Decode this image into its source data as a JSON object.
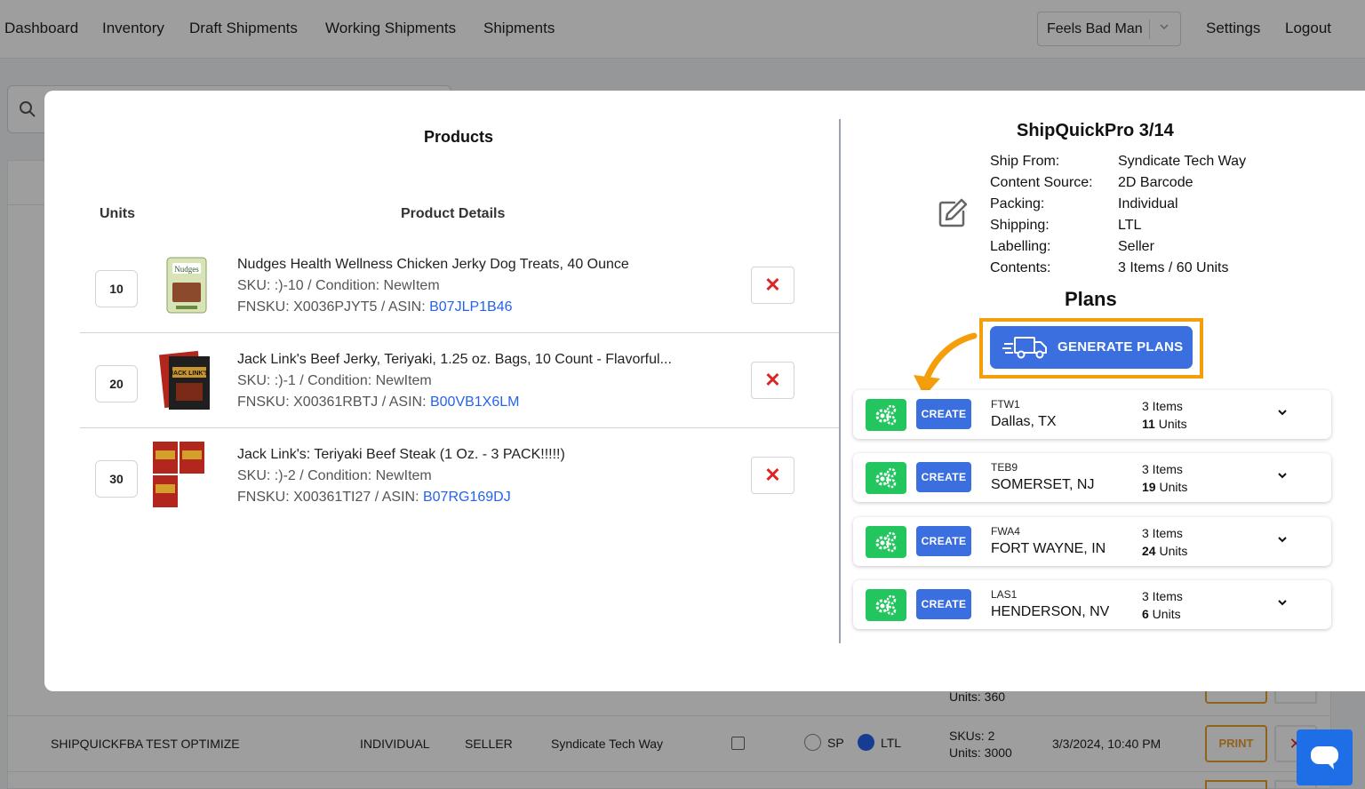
{
  "nav": {
    "items": [
      "Dashboard",
      "Inventory",
      "Draft Shipments",
      "Working Shipments",
      "Shipments"
    ],
    "account": "Feels Bad Man",
    "settings": "Settings",
    "logout": "Logout"
  },
  "background_row": {
    "name": "SHIPQUICKFBA TEST OPTIMIZE",
    "packing": "INDIVIDUAL",
    "labelling": "SELLER",
    "ship_from": "Syndicate Tech Way",
    "sp_label": "SP",
    "ltl_label": "LTL",
    "skus": "SKUs: 2",
    "units": "Units: 3000",
    "date": "3/3/2024, 10:40 PM",
    "print_label": "PRINT",
    "prev_units": "Units: 360"
  },
  "products": {
    "title": "Products",
    "col_units": "Units",
    "col_details": "Product Details",
    "items": [
      {
        "qty": "10",
        "name": "Nudges Health Wellness Chicken Jerky Dog Treats, 40 Ounce",
        "sku": "SKU: :)-10 / Condition: NewItem",
        "fnsku": "FNSKU: X0036PJYT5 / ASIN: ",
        "asin": "B07JLP1B46"
      },
      {
        "qty": "20",
        "name": "Jack Link's Beef Jerky, Teriyaki, 1.25 oz. Bags, 10 Count - Flavorful...",
        "sku": "SKU: :)-1 / Condition: NewItem",
        "fnsku": "FNSKU: X00361RBTJ / ASIN: ",
        "asin": "B00VB1X6LM"
      },
      {
        "qty": "30",
        "name": "Jack Link's: Teriyaki Beef Steak (1 Oz. - 3 PACK!!!!!)",
        "sku": "SKU: :)-2 / Condition: NewItem",
        "fnsku": "FNSKU: X00361TI27 / ASIN: ",
        "asin": "B07RG169DJ"
      }
    ]
  },
  "shipment": {
    "title": "ShipQuickPro 3/14",
    "info": [
      {
        "label": "Ship From:",
        "value": "Syndicate Tech Way"
      },
      {
        "label": "Content Source:",
        "value": "2D Barcode"
      },
      {
        "label": "Packing:",
        "value": "Individual"
      },
      {
        "label": "Shipping:",
        "value": "LTL"
      },
      {
        "label": "Labelling:",
        "value": "Seller"
      },
      {
        "label": "Contents:",
        "value": "3 Items / 60 Units"
      }
    ],
    "plans_title": "Plans",
    "generate_label": "GENERATE PLANS",
    "create_label": "CREATE",
    "plans": [
      {
        "code": "FTW1",
        "city": "Dallas, TX",
        "items": "3 Items",
        "units_num": "11",
        "units_word": " Units"
      },
      {
        "code": "TEB9",
        "city": "SOMERSET, NJ",
        "items": "3 Items",
        "units_num": "19",
        "units_word": " Units"
      },
      {
        "code": "FWA4",
        "city": "FORT WAYNE, IN",
        "items": "3 Items",
        "units_num": "24",
        "units_word": " Units"
      },
      {
        "code": "LAS1",
        "city": "HENDERSON, NV",
        "items": "3 Items",
        "units_num": "6",
        "units_word": " Units"
      }
    ]
  },
  "colors": {
    "accent_blue": "#3b6fe0",
    "highlight_orange": "#f59e0b",
    "gear_green": "#22c55e",
    "delete_red": "#dc2626"
  }
}
